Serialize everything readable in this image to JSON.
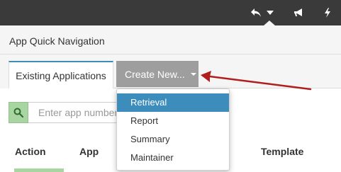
{
  "topbar": {
    "icons": [
      "reply-icon",
      "chevron-down-icon",
      "megaphone-icon",
      "bolt-icon"
    ]
  },
  "panel": {
    "title": "App Quick Navigation"
  },
  "tabs": {
    "existing_label": "Existing Applications",
    "create_label": "Create New..."
  },
  "search": {
    "placeholder": "Enter app number"
  },
  "table": {
    "headers": [
      "Action",
      "App",
      "Template"
    ]
  },
  "dropdown": {
    "items": [
      "Retrieval",
      "Report",
      "Summary",
      "Maintainer"
    ],
    "highlighted": "Retrieval"
  },
  "colors": {
    "topbar": "#3a3a3a",
    "accent": "#3c8dbc",
    "create_button": "#9e9e9e",
    "search_button": "#a9d5a3",
    "annotation_arrow": "#b01e1e"
  }
}
